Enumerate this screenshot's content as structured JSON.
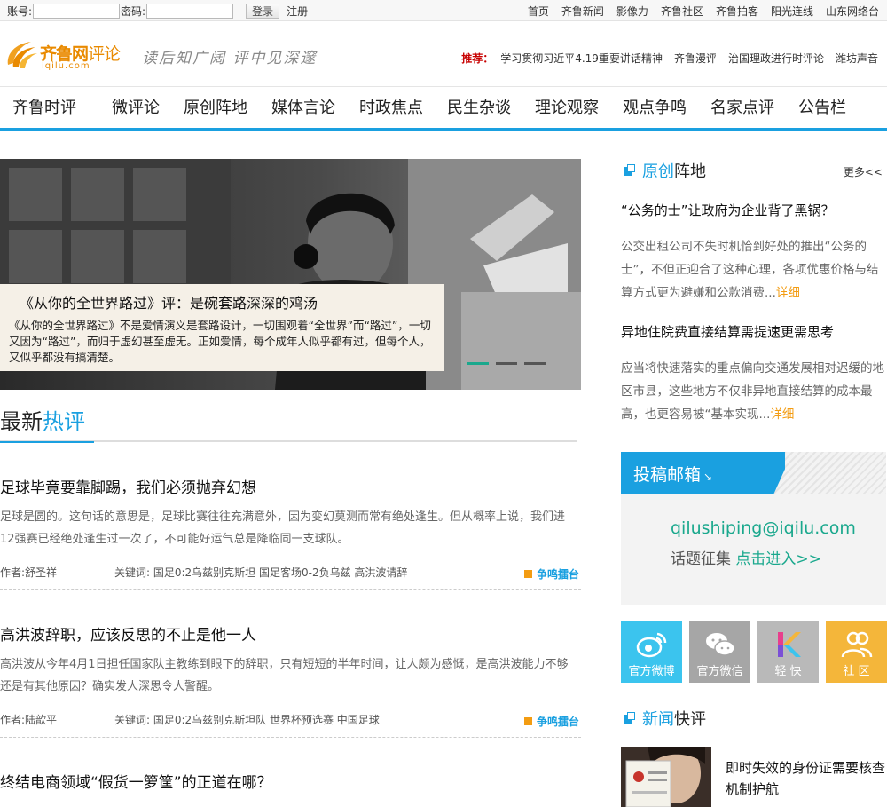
{
  "topbar": {
    "account_label": "账号:",
    "password_label": "密码:",
    "login_label": "登录",
    "register_label": "注册",
    "links": [
      "首页",
      "齐鲁新闻",
      "影像力",
      "齐鲁社区",
      "齐鲁拍客",
      "阳光连线",
      "山东网络台"
    ]
  },
  "header": {
    "logo_cn": "齐鲁网",
    "logo_rev": "评论",
    "logo_en": "iqilu.com",
    "slogan": "读后知广阔  评中见深邃",
    "recommend_label": "推荐：",
    "recommend_links": [
      "学习贯彻习近平4.19重要讲话精神",
      "齐鲁漫评",
      "治国理政进行时评论",
      "潍坊声音"
    ]
  },
  "nav": [
    "齐鲁时评",
    "微评论",
    "原创阵地",
    "媒体言论",
    "时政焦点",
    "民生杂谈",
    "理论观察",
    "观点争鸣",
    "名家点评",
    "公告栏"
  ],
  "slider": {
    "title": "《从你的全世界路过》评：是碗套路深深的鸡汤",
    "desc": "《从你的全世界路过》不是爱情演义是套路设计，一切围观着“全世界”而“路过”，一切又因为“路过”，而归于虚幻甚至虚无。正如爱情，每个成年人似乎都有过，但每个人，又似乎都没有搞清楚。"
  },
  "latest": {
    "title_plain": "最新",
    "title_hl": "热评",
    "articles": [
      {
        "title": "足球毕竟要靠脚踢，我们必须抛弃幻想",
        "desc": "足球是圆的。这句话的意思是，足球比赛往往充满意外，因为变幻莫测而常有绝处逢生。但从概率上说，我们进12强赛已经绝处逢生过一次了，不可能好运气总是降临同一支球队。",
        "author": "作者:舒圣祥",
        "keywords": "关键词: 国足0:2乌兹别克斯坦 国足客场0-2负乌兹 高洪波请辞",
        "tag": "争鸣擂台"
      },
      {
        "title": "高洪波辞职，应该反思的不止是他一人",
        "desc": "高洪波从今年4月1日担任国家队主教练到眼下的辞职，只有短短的半年时间，让人颇为感慨，是高洪波能力不够还是有其他原因？确实发人深思令人警醒。",
        "author": "作者:陆歆平",
        "keywords": "关键词: 国足0:2乌兹别克斯坦队 世界杯预选赛 中国足球",
        "tag": "争鸣擂台"
      },
      {
        "title": "终结电商领域“假货一箩筐”的正道在哪？",
        "desc": "",
        "author": "",
        "keywords": "",
        "tag": ""
      }
    ]
  },
  "original": {
    "title_hl": "原创",
    "title_plain": "阵地",
    "more": "更多<<",
    "items": [
      {
        "title": "“公务的士”让政府为企业背了黑锅？",
        "desc": "公交出租公司不失时机恰到好处的推出“公务的士”，不但正迎合了这种心理，各项优惠价格与结算方式更为避嫌和公款消费...",
        "detail": "详细"
      },
      {
        "title": "异地住院费直接结算需提速更需思考",
        "desc": "应当将快速落实的重点偏向交通发展相对迟缓的地区市县，这些地方不仅非异地直接结算的成本最高，也更容易被“基本实现...",
        "detail": "详细"
      }
    ]
  },
  "mailbox": {
    "title": "投稿邮箱",
    "email": "qilushiping@iqilu.com",
    "topic_label": "话题征集",
    "topic_link": "点击进入>>"
  },
  "social": [
    {
      "label": "官方微博",
      "icon": "weibo-icon",
      "color": "#3bc4ee"
    },
    {
      "label": "官方微信",
      "icon": "wechat-icon",
      "color": "#a6a6a6"
    },
    {
      "label": "轻 快",
      "icon": "qingkuai-icon",
      "color": "#b9b9b9"
    },
    {
      "label": "社 区",
      "icon": "community-icon",
      "color": "#f4b63a"
    }
  ],
  "news": {
    "title_hl": "新闻",
    "title_plain": "快评",
    "item_title": "即时失效的身份证需要核查机制护航"
  },
  "colors": {
    "accent": "#1aa0e0",
    "brand": "#e98a00",
    "green": "#1aa88d",
    "orange": "#f39c12"
  }
}
